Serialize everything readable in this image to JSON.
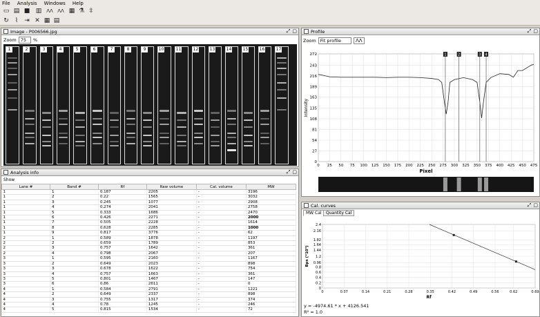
{
  "menu": [
    "File",
    "Analysis",
    "Windows",
    "Help"
  ],
  "toolbar": {
    "icons": [
      "new-icon",
      "open-icon",
      "save-icon",
      "lanes-icon",
      "bands-icon",
      "bands-auto-icon",
      "grid-icon",
      "flask-icon",
      "align-icon",
      "rotate-icon",
      "pipette-icon",
      "split-icon",
      "delete-icon",
      "table-icon",
      "report-icon"
    ]
  },
  "image_panel": {
    "title": "Image - P006566.jpg",
    "zoom_label": "Zoom",
    "zoom_value": "75",
    "zoom_unit": "%",
    "lanes": [
      "1",
      "2",
      "3",
      "4",
      "5",
      "6",
      "7",
      "8",
      "9",
      "10",
      "11",
      "12",
      "13",
      "14",
      "15",
      "16",
      "17"
    ]
  },
  "profile_panel": {
    "title": "Profile",
    "zoom_label": "Zoom",
    "zoom_value": "Fit profile",
    "markers": [
      "1",
      "2",
      "3",
      "4"
    ]
  },
  "analysis_panel": {
    "title": "Analysis info",
    "show_label": "Show",
    "columns": [
      "Lane #",
      "Band #",
      "Rf",
      "Raw volume",
      "Cal. volume",
      "MW"
    ],
    "rows": [
      [
        "1",
        "1",
        "0.187",
        "2205",
        "-",
        "3196"
      ],
      [
        "1",
        "2",
        "0.22",
        "1565",
        "-",
        "3032"
      ],
      [
        "1",
        "3",
        "0.245",
        "1077",
        "-",
        "2908"
      ],
      [
        "1",
        "4",
        "0.274",
        "2041",
        "-",
        "2758"
      ],
      [
        "1",
        "5",
        "0.333",
        "1686",
        "-",
        "2470"
      ],
      [
        "1",
        "6",
        "0.426",
        "2271",
        "-",
        "2000"
      ],
      [
        "1",
        "7",
        "0.505",
        "2228",
        "-",
        "1614"
      ],
      [
        "1",
        "8",
        "0.628",
        "2285",
        "-",
        "1000"
      ],
      [
        "1",
        "9",
        "0.817",
        "3776",
        "-",
        "62"
      ],
      [
        "2",
        "1",
        "0.589",
        "1878",
        "-",
        "1197"
      ],
      [
        "2",
        "2",
        "0.659",
        "1789",
        "-",
        "853"
      ],
      [
        "2",
        "3",
        "0.757",
        "1642",
        "-",
        "361"
      ],
      [
        "2",
        "4",
        "0.798",
        "2067",
        "-",
        "207"
      ],
      [
        "3",
        "1",
        "0.595",
        "2160",
        "-",
        "1167"
      ],
      [
        "3",
        "2",
        "0.649",
        "2023",
        "-",
        "898"
      ],
      [
        "3",
        "3",
        "0.678",
        "1622",
        "-",
        "754"
      ],
      [
        "3",
        "4",
        "0.757",
        "1663",
        "-",
        "361"
      ],
      [
        "3",
        "5",
        "0.801",
        "1467",
        "-",
        "147"
      ],
      [
        "3",
        "6",
        "0.86",
        "2611",
        "-",
        "0"
      ],
      [
        "4",
        "1",
        "0.584",
        "2791",
        "-",
        "1221"
      ],
      [
        "4",
        "2",
        "0.649",
        "2337",
        "-",
        "898"
      ],
      [
        "4",
        "3",
        "0.755",
        "1317",
        "-",
        "374"
      ],
      [
        "4",
        "4",
        "0.78",
        "1245",
        "-",
        "246"
      ],
      [
        "4",
        "5",
        "0.815",
        "1534",
        "-",
        "72"
      ]
    ],
    "bold_mw": [
      "2000",
      "1000"
    ]
  },
  "cal_panel": {
    "title": "Cal. curves",
    "tabs": [
      "MW Cal",
      "Quantity Cal"
    ],
    "equation": "y = -4974.61 * x + 4126.541",
    "r2": "R² = 1.0"
  },
  "chart_data": [
    {
      "type": "line",
      "title": "",
      "xlabel": "Pixel",
      "ylabel": "Intensity",
      "xlim": [
        0,
        475
      ],
      "ylim": [
        0,
        272
      ],
      "xticks": [
        0,
        25,
        50,
        75,
        100,
        125,
        150,
        175,
        200,
        225,
        250,
        275,
        300,
        325,
        350,
        375,
        400,
        425,
        450,
        475
      ],
      "yticks": [
        0,
        27,
        54,
        81,
        108,
        135,
        163,
        189,
        216,
        243,
        272
      ],
      "x": [
        0,
        10,
        25,
        50,
        75,
        100,
        125,
        150,
        175,
        200,
        225,
        250,
        265,
        272,
        278,
        282,
        286,
        290,
        300,
        320,
        340,
        350,
        356,
        360,
        364,
        370,
        380,
        400,
        420,
        430,
        440,
        450,
        460,
        470,
        475
      ],
      "y": [
        220,
        218,
        214,
        213,
        213,
        213,
        213,
        212,
        213,
        213,
        212,
        210,
        207,
        200,
        150,
        120,
        150,
        200,
        207,
        212,
        207,
        200,
        150,
        110,
        150,
        200,
        212,
        222,
        220,
        213,
        230,
        230,
        237,
        244,
        245
      ],
      "markers_x": [
        280,
        310,
        356,
        370
      ]
    },
    {
      "type": "scatter",
      "title": "",
      "xlabel": "Rf",
      "ylabel": "Bps (*10³)",
      "xlim": [
        0,
        0.69
      ],
      "ylim": [
        0,
        2.4
      ],
      "xticks": [
        0,
        0.07,
        0.14,
        0.21,
        0.28,
        0.35,
        0.42,
        0.49,
        0.56,
        0.62,
        0.69
      ],
      "yticks": [
        0,
        0.2,
        0.4,
        0.6,
        0.8,
        0.96,
        1.2,
        1.44,
        1.64,
        1.82,
        2.16,
        2.4
      ],
      "x": [
        0.426,
        0.628
      ],
      "y": [
        2.0,
        1.0
      ],
      "fit": {
        "slope": -4.97461,
        "intercept": 4.126541
      }
    }
  ]
}
